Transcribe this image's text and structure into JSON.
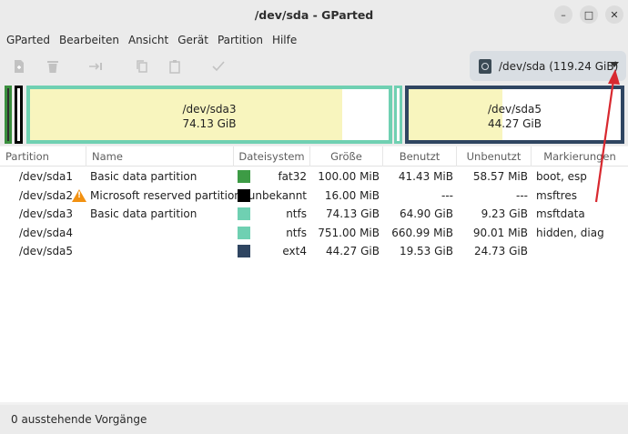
{
  "window": {
    "title": "/dev/sda - GParted"
  },
  "window_controls": {
    "minimize": "–",
    "maximize": "□",
    "close": "✕"
  },
  "menubar": [
    "GParted",
    "Bearbeiten",
    "Ansicht",
    "Gerät",
    "Partition",
    "Hilfe"
  ],
  "toolbar": {
    "icons": [
      "new-partition-icon",
      "delete-icon",
      "resize-move-icon",
      "copy-icon",
      "paste-icon",
      "apply-icon"
    ],
    "device_selector": "/dev/sda (119.24 GiB)"
  },
  "diskmap": {
    "sda3": {
      "name": "/dev/sda3",
      "size": "74.13 GiB",
      "used_fraction": 0.87
    },
    "sda5": {
      "name": "/dev/sda5",
      "size": "44.27 GiB",
      "used_fraction": 0.44
    }
  },
  "table": {
    "headers": [
      "Partition",
      "Name",
      "Dateisystem",
      "Größe",
      "Benutzt",
      "Unbenutzt",
      "Markierungen"
    ],
    "rows": [
      {
        "partition": "/dev/sda1",
        "name": "Basic data partition",
        "fs": "fat32",
        "fs_color": "#3d9b45",
        "size": "100.00 MiB",
        "used": "41.43 MiB",
        "unused": "58.57 MiB",
        "flags": "boot, esp",
        "warning": false
      },
      {
        "partition": "/dev/sda2",
        "name": "Microsoft reserved partition",
        "fs": "unbekannt",
        "fs_color": "#000000",
        "size": "16.00 MiB",
        "used": "---",
        "unused": "---",
        "flags": "msftres",
        "warning": true
      },
      {
        "partition": "/dev/sda3",
        "name": "Basic data partition",
        "fs": "ntfs",
        "fs_color": "#6fd0b2",
        "size": "74.13 GiB",
        "used": "64.90 GiB",
        "unused": "9.23 GiB",
        "flags": "msftdata",
        "warning": false
      },
      {
        "partition": "/dev/sda4",
        "name": "",
        "fs": "ntfs",
        "fs_color": "#6fd0b2",
        "size": "751.00 MiB",
        "used": "660.99 MiB",
        "unused": "90.01 MiB",
        "flags": "hidden, diag",
        "warning": false
      },
      {
        "partition": "/dev/sda5",
        "name": "",
        "fs": "ext4",
        "fs_color": "#2f4561",
        "size": "44.27 GiB",
        "used": "19.53 GiB",
        "unused": "24.73 GiB",
        "flags": "",
        "warning": false
      }
    ]
  },
  "statusbar": {
    "text": "0 ausstehende Vorgänge"
  },
  "colors": {
    "annotation_arrow": "#d8282f"
  }
}
